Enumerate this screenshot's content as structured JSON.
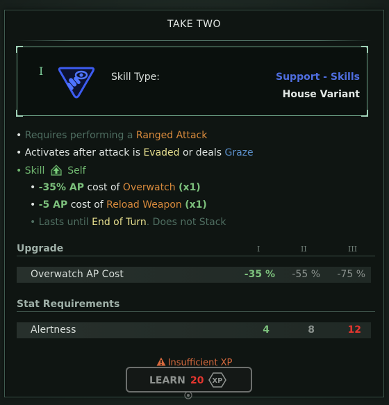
{
  "title": "TAKE TWO",
  "skill": {
    "rank": "I",
    "type_label": "Skill Type:",
    "type_value": "Support - Skills",
    "variant": "House Variant",
    "icon": "eye-bullet-emblem-icon"
  },
  "description": {
    "line1": {
      "prefix": "Requires performing a",
      "highlight": "Ranged Attack"
    },
    "line2": {
      "prefix": "Activates after attack is",
      "evaded": "Evaded",
      "mid": "or deals",
      "graze": "Graze"
    },
    "line3": {
      "skill": "Skill",
      "self": "Self"
    },
    "line4": {
      "value": "-35% AP",
      "cost_of": "cost of",
      "target": "Overwatch",
      "mult": "(x1)"
    },
    "line5": {
      "value": "-5 AP",
      "cost_of": "cost of",
      "target": "Reload Weapon",
      "mult": "(x1)"
    },
    "line6": {
      "prefix": "Lasts until",
      "highlight": "End of Turn",
      "suffix": ". Does not Stack"
    }
  },
  "upgrade": {
    "header": "Upgrade",
    "levels": [
      "I",
      "II",
      "III"
    ],
    "row": {
      "name": "Overwatch AP Cost",
      "values": [
        "-35 %",
        "-55 %",
        "-75 %"
      ]
    }
  },
  "stats": {
    "header": "Stat Requirements",
    "row": {
      "name": "Alertness",
      "values": [
        "4",
        "8",
        "12"
      ]
    }
  },
  "warning": "Insufficient XP",
  "learn": {
    "label": "LEARN",
    "cost": "20",
    "currency": "XP"
  },
  "colors": {
    "accent_green": "#7cc07c",
    "orange": "#d88a3c",
    "blue": "#5b8fc9",
    "warning": "#d86a3e",
    "cost_red": "#e4362f"
  }
}
